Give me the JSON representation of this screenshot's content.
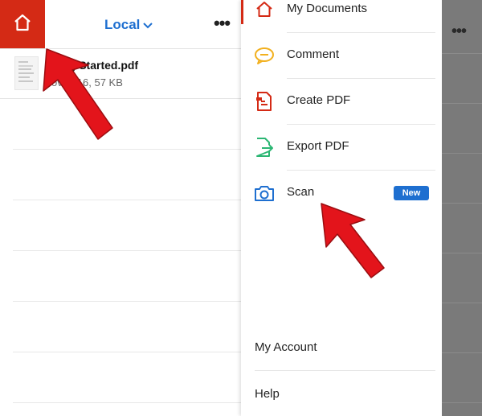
{
  "topbar": {
    "location_label": "Local",
    "more_label": "•••"
  },
  "file": {
    "name": "Getting Started.pdf",
    "name_visible": "tting Started.pdf",
    "meta": "Nov 2016, 57 KB",
    "meta_visible": "ov 2016, 57 KB"
  },
  "drawer": {
    "items": [
      {
        "label": "My Documents",
        "icon": "home-icon",
        "color": "#d42a15"
      },
      {
        "label": "Comment",
        "icon": "comment-icon",
        "color": "#f2b01e"
      },
      {
        "label": "Create PDF",
        "icon": "create-pdf-icon",
        "color": "#d42a15"
      },
      {
        "label": "Export PDF",
        "icon": "export-pdf-icon",
        "color": "#2bb673"
      },
      {
        "label": "Scan",
        "icon": "camera-icon",
        "color": "#1e6fd0",
        "badge": "New"
      }
    ],
    "bottom_items": [
      "My Account",
      "Help"
    ]
  },
  "dimmed": {
    "more_label": "•••"
  },
  "colors": {
    "brand_red": "#d42a15",
    "accent_blue": "#1e6fd0",
    "annotation_red": "#e3141b"
  }
}
